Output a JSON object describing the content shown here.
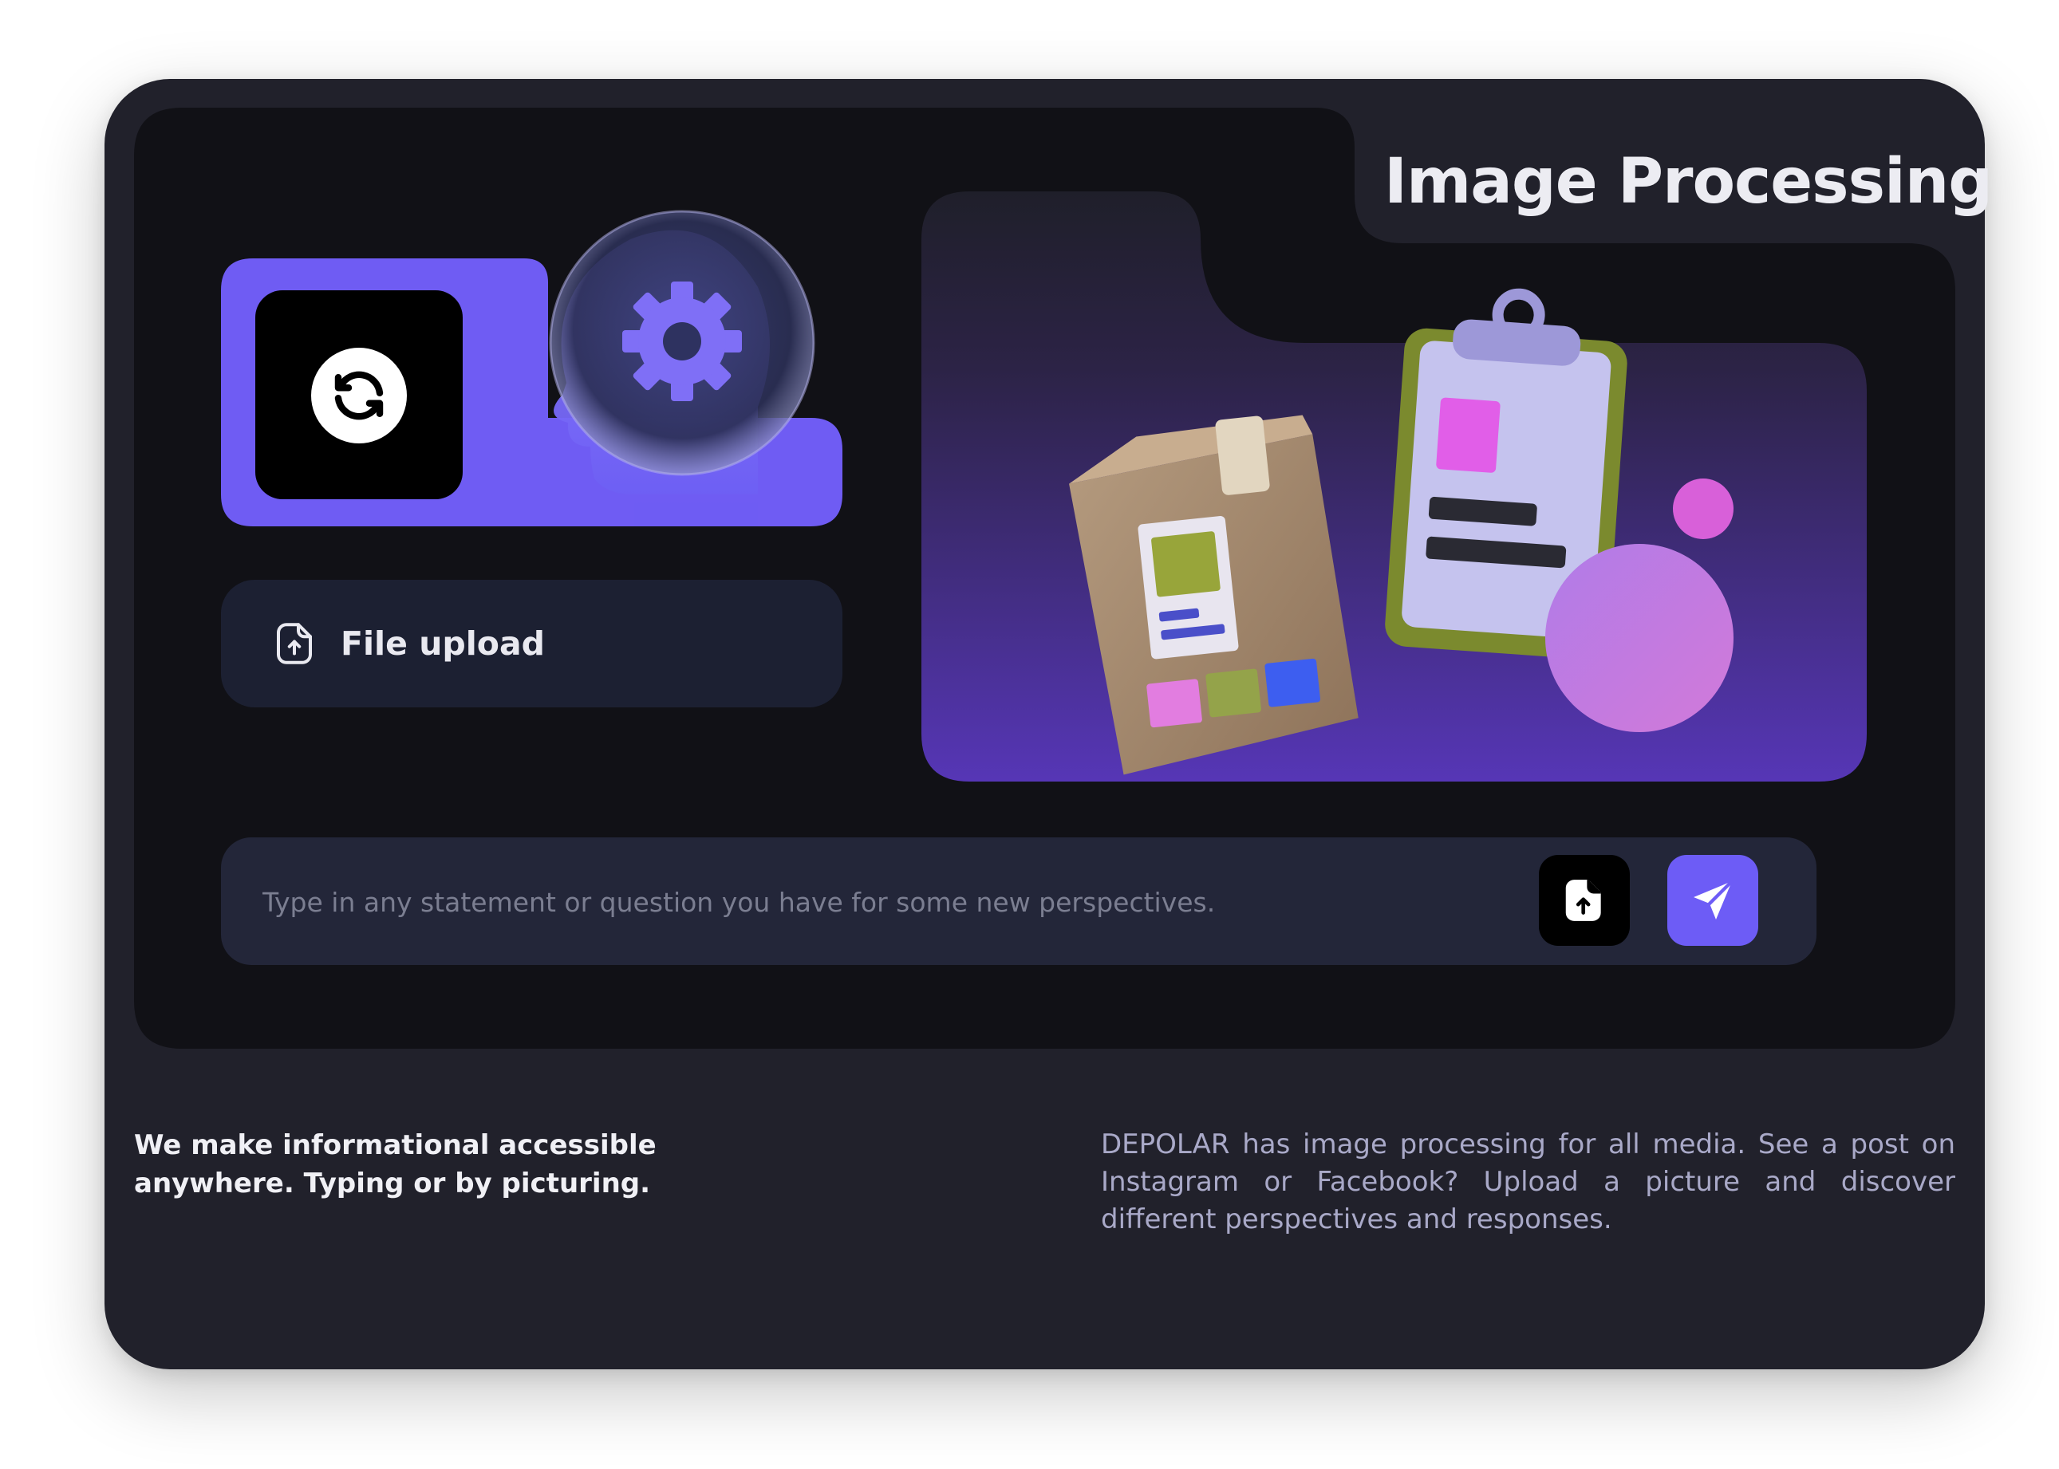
{
  "header": {
    "title": "Image Processing"
  },
  "feature_card": {
    "sync_icon": "sync-icon",
    "illustration": "ai-head-gear-icon"
  },
  "upload": {
    "icon": "file-upload-icon",
    "label": "File upload"
  },
  "illustration": {
    "description_icon": "package-clipboard-illustration"
  },
  "prompt": {
    "placeholder": "Type in any statement or question you have for some new perspectives.",
    "value": "",
    "attach_icon": "file-attach-icon",
    "send_icon": "send-icon"
  },
  "footer": {
    "tagline": "We make informational accessible anywhere. Typing or by picturing.",
    "description": "DEPOLAR has image processing for all media. See a post on Instagram or Facebook? Upload a picture and discover different perspectives and responses."
  },
  "colors": {
    "card": "#21212b",
    "inner": "#111116",
    "accent": "#6d5cf6",
    "input": "#232639"
  }
}
